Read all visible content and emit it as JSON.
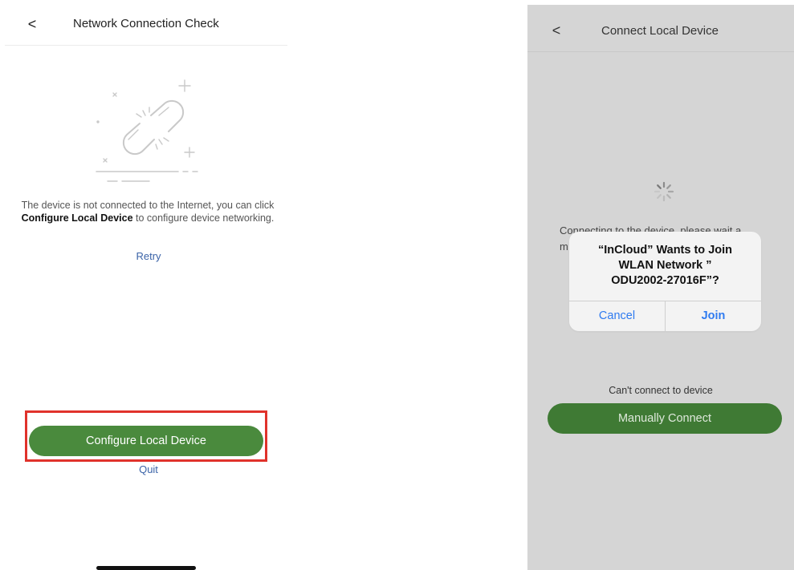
{
  "left": {
    "title": "Network Connection Check",
    "back_icon": "chevron-left-icon",
    "back_glyph": "<",
    "illustration_icon": "broken-link-icon",
    "message_before": "The device is not connected to the Internet, you can click ",
    "message_bold": "Configure Local Device",
    "message_after": " to configure device networking.",
    "retry_label": "Retry",
    "configure_button_label": "Configure Local Device",
    "quit_label": "Quit",
    "colors": {
      "primary_button": "#4a8a3d",
      "link": "#3c64a8",
      "highlight_frame": "#e0322b"
    }
  },
  "right": {
    "title": "Connect Local Device",
    "back_icon": "chevron-left-icon",
    "back_glyph": "<",
    "spinner_icon": "loading-spinner-icon",
    "connecting_line1": "Connecting to the device, please wait a",
    "connecting_line2": "m",
    "dialog": {
      "title_line1": "“InCloud” Wants to Join",
      "title_line2": "WLAN Network ”",
      "title_line3": "ODU2002-27016F”?",
      "cancel_label": "Cancel",
      "join_label": "Join"
    },
    "cant_connect_text": "Can't connect to device",
    "manually_connect_label": "Manually Connect",
    "colors": {
      "overlay_background": "#d5d5d5",
      "dialog_button_text": "#2f7bf0",
      "primary_button": "#3f7a34"
    }
  }
}
